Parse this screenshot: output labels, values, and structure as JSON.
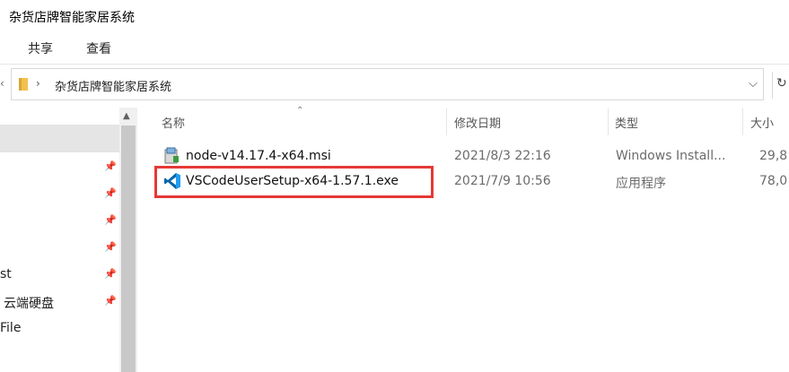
{
  "window": {
    "title": "杂货店牌智能家居系统"
  },
  "ribbon": {
    "tabs": [
      "共享",
      "查看"
    ]
  },
  "address_bar": {
    "path": "杂货店牌智能家居系统",
    "folder_icon": "folder-icon",
    "dropdown_icon": "chevron-down-icon",
    "refresh_icon": "refresh-icon"
  },
  "nav_pane": {
    "items": [
      {
        "label": "",
        "pinned": false,
        "selected": true
      },
      {
        "label": "",
        "pinned": true
      },
      {
        "label": "",
        "pinned": true
      },
      {
        "label": "",
        "pinned": true
      },
      {
        "label": "",
        "pinned": true
      },
      {
        "label": "st",
        "pinned": true
      },
      {
        "label": "云端硬盘",
        "pinned": true
      },
      {
        "label": "File",
        "pinned": false
      }
    ]
  },
  "columns": {
    "name": "名称",
    "modified": "修改日期",
    "type": "类型",
    "size": "大小"
  },
  "files": [
    {
      "name": "node-v14.17.4-x64.msi",
      "modified": "2021/8/3 22:16",
      "type": "Windows Install...",
      "size": "29,8",
      "icon": "msi-installer-icon"
    },
    {
      "name": "VSCodeUserSetup-x64-1.57.1.exe",
      "modified": "2021/7/9 10:56",
      "type": "应用程序",
      "size": "78,0",
      "icon": "vscode-icon",
      "highlighted": true
    }
  ],
  "colors": {
    "highlight_border": "#e53935",
    "selection": "#e5e5e5",
    "vscode_blue": "#0065a9"
  }
}
